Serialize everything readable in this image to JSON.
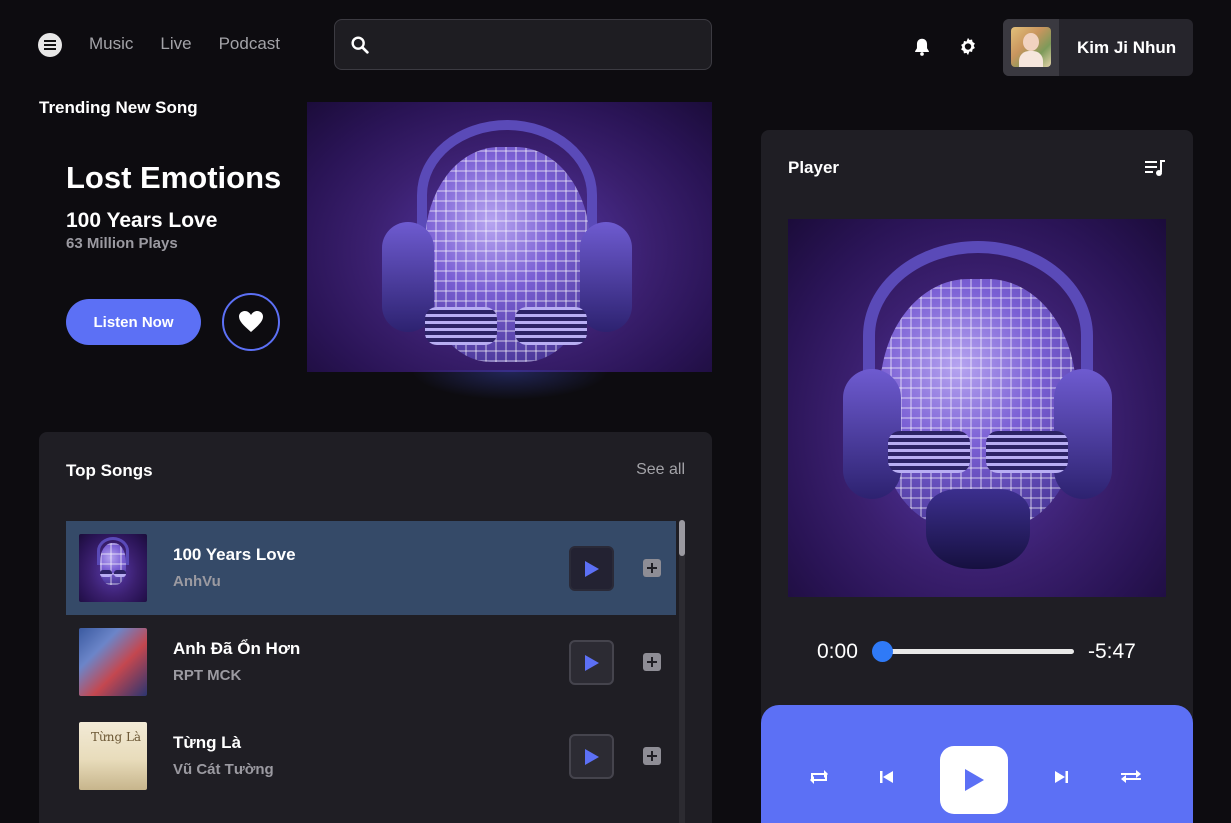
{
  "header": {
    "nav": [
      "Music",
      "Live",
      "Podcast"
    ],
    "search": {
      "placeholder": "",
      "value": ""
    },
    "user": {
      "name": "Kim Ji Nhun"
    }
  },
  "trending": {
    "label": "Trending New Song",
    "title": "Lost Emotions",
    "song": "100 Years Love",
    "plays": "63 Million Plays",
    "listen_label": "Listen Now"
  },
  "top_songs": {
    "title": "Top Songs",
    "see_all": "See all",
    "songs": [
      {
        "title": "100 Years Love",
        "artist": "AnhVu",
        "active": true
      },
      {
        "title": "Anh Đã Ổn Hơn",
        "artist": "RPT MCK",
        "active": false
      },
      {
        "title": "Từng Là",
        "artist": "Vũ Cát Tường",
        "active": false
      }
    ]
  },
  "player": {
    "title": "Player",
    "current_time": "0:00",
    "remaining_time": "-5:47",
    "progress": 0.0
  },
  "colors": {
    "accent": "#5c70f5",
    "progress": "#2f7af7",
    "background": "#0d0c10",
    "panel": "#1f1e24",
    "active_row": "#354a68"
  },
  "icons": [
    "menu-icon",
    "search-icon",
    "bell-icon",
    "gear-icon",
    "heart-icon",
    "play-icon",
    "add-icon",
    "queue-icon",
    "repeat-icon",
    "previous-icon",
    "next-icon",
    "shuffle-icon"
  ]
}
